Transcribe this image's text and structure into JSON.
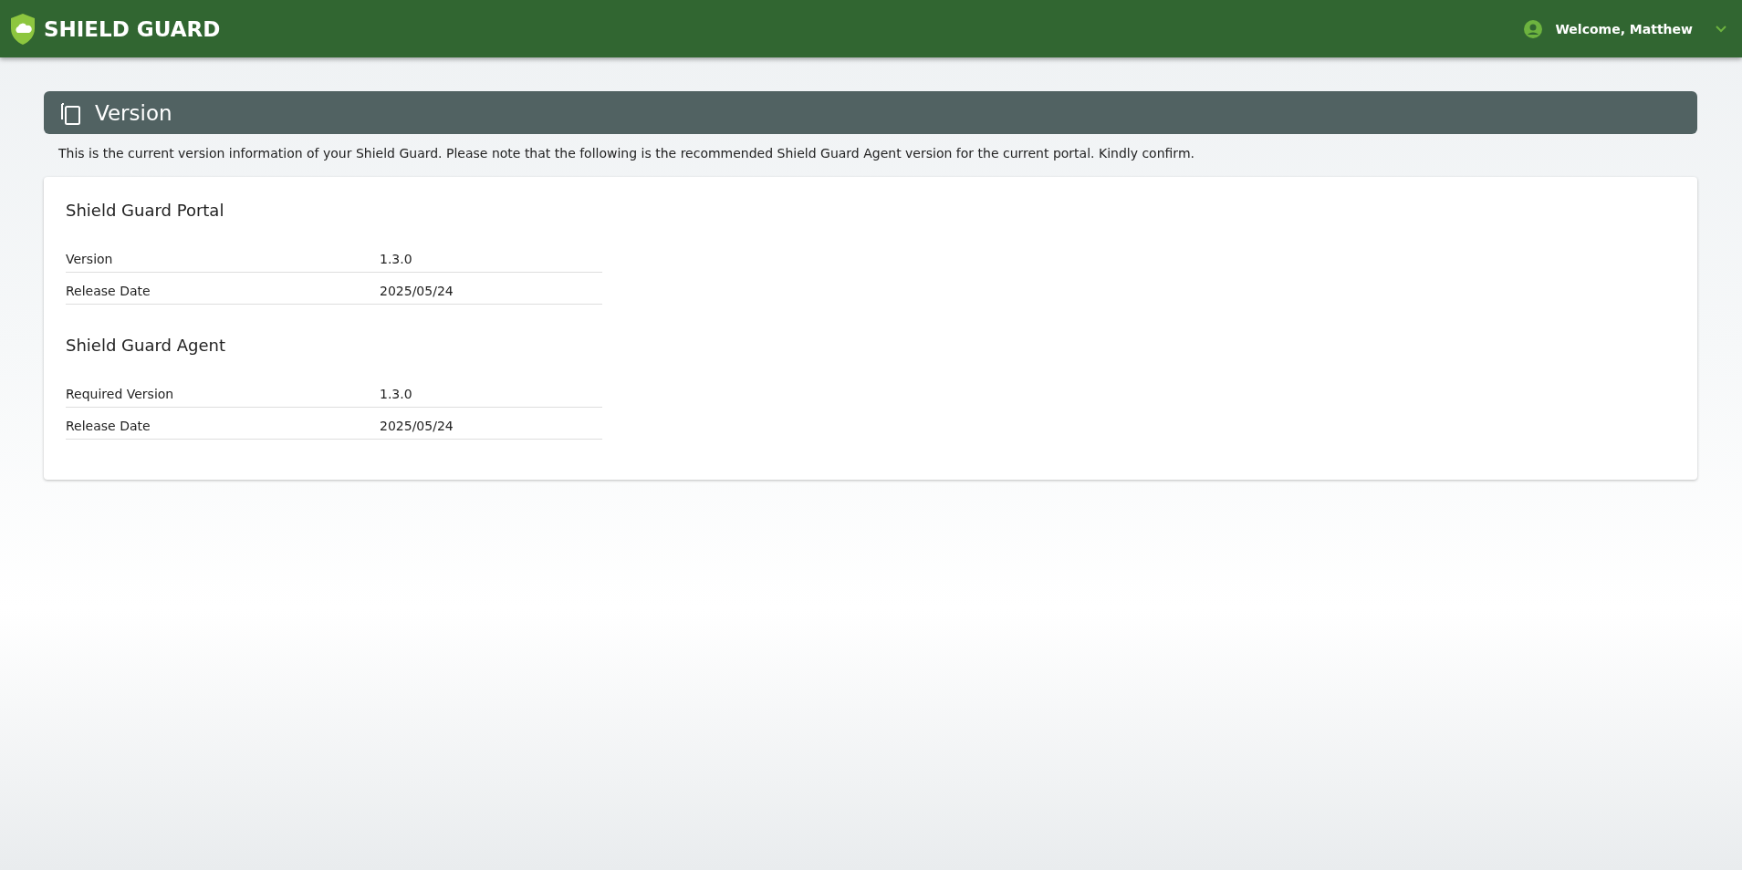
{
  "header": {
    "brand": "SHIELD GUARD",
    "user": "Welcome, Matthew"
  },
  "page": {
    "title": "Version",
    "description": "This is the current version information of your Shield Guard. Please note that the following is the recommended Shield Guard Agent version for the current portal. Kindly confirm."
  },
  "sections": [
    {
      "title": "Shield Guard Portal",
      "rows": [
        {
          "label": "Version",
          "value": "1.3.0"
        },
        {
          "label": "Release Date",
          "value": "2025/05/24"
        }
      ]
    },
    {
      "title": "Shield Guard Agent",
      "rows": [
        {
          "label": "Required Version",
          "value": "1.3.0"
        },
        {
          "label": "Release Date",
          "value": "2025/05/24"
        }
      ]
    }
  ]
}
